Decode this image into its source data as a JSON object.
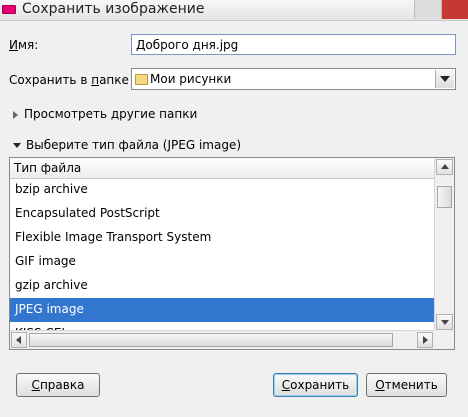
{
  "window": {
    "title": "Сохранить изображение",
    "title_icon": "app-icon",
    "accent_color": "#e8006e"
  },
  "form": {
    "name_label_underlined": "И",
    "name_label_rest": "мя:",
    "name_value": "Доброго дня.jpg",
    "folder_label_pre": "Сохранить в ",
    "folder_label_underlined": "п",
    "folder_label_post": "апке",
    "folder_value": "Мои рисунки",
    "folder_icon": "folder-icon"
  },
  "expanders": {
    "browse_label": "Просмотреть другие папки",
    "filetype_label": "Выберите тип файла (JPEG image)"
  },
  "filetype_list": {
    "column_header": "Тип файла",
    "items": [
      "bzip archive",
      "Encapsulated PostScript",
      "Flexible Image Transport System",
      "GIF image",
      "gzip archive",
      "JPEG image",
      "KISS CEL"
    ],
    "selected": "JPEG image",
    "selection_color": "#3276d0"
  },
  "buttons": {
    "help_underlined": "С",
    "help_rest": "правка",
    "save_underlined": "С",
    "save_rest": "охранить",
    "cancel_underlined": "О",
    "cancel_rest": "тменить"
  }
}
